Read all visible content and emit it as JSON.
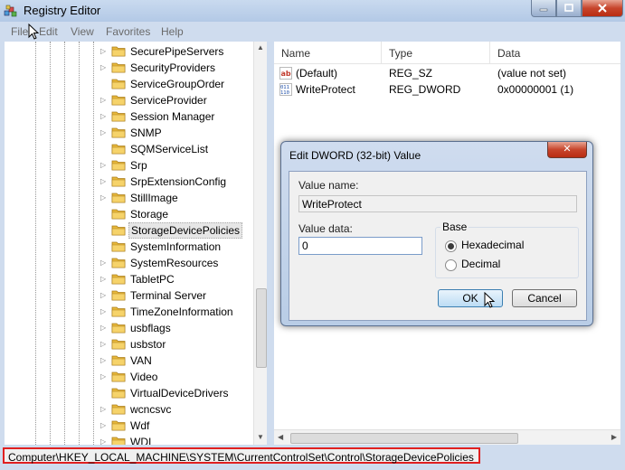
{
  "window": {
    "title": "Registry Editor"
  },
  "menu": [
    {
      "id": "file",
      "label": "File"
    },
    {
      "id": "edit",
      "label": "Edit"
    },
    {
      "id": "view",
      "label": "View"
    },
    {
      "id": "favorites",
      "label": "Favorites"
    },
    {
      "id": "help",
      "label": "Help"
    }
  ],
  "tree": {
    "items": [
      {
        "label": "SecurePipeServers",
        "expandable": true
      },
      {
        "label": "SecurityProviders",
        "expandable": true
      },
      {
        "label": "ServiceGroupOrder",
        "expandable": false
      },
      {
        "label": "ServiceProvider",
        "expandable": true
      },
      {
        "label": "Session Manager",
        "expandable": true
      },
      {
        "label": "SNMP",
        "expandable": true
      },
      {
        "label": "SQMServiceList",
        "expandable": false
      },
      {
        "label": "Srp",
        "expandable": true
      },
      {
        "label": "SrpExtensionConfig",
        "expandable": true
      },
      {
        "label": "StillImage",
        "expandable": true
      },
      {
        "label": "Storage",
        "expandable": false
      },
      {
        "label": "StorageDevicePolicies",
        "expandable": false,
        "selected": true
      },
      {
        "label": "SystemInformation",
        "expandable": false
      },
      {
        "label": "SystemResources",
        "expandable": true
      },
      {
        "label": "TabletPC",
        "expandable": true
      },
      {
        "label": "Terminal Server",
        "expandable": true
      },
      {
        "label": "TimeZoneInformation",
        "expandable": true
      },
      {
        "label": "usbflags",
        "expandable": true
      },
      {
        "label": "usbstor",
        "expandable": true
      },
      {
        "label": "VAN",
        "expandable": true
      },
      {
        "label": "Video",
        "expandable": true
      },
      {
        "label": "VirtualDeviceDrivers",
        "expandable": false
      },
      {
        "label": "wcncsvc",
        "expandable": true
      },
      {
        "label": "Wdf",
        "expandable": true
      },
      {
        "label": "WDI",
        "expandable": true
      }
    ]
  },
  "list": {
    "columns": [
      "Name",
      "Type",
      "Data"
    ],
    "rows": [
      {
        "icon": "string-value-icon",
        "name": "(Default)",
        "type": "REG_SZ",
        "data": "(value not set)"
      },
      {
        "icon": "binary-value-icon",
        "name": "WriteProtect",
        "type": "REG_DWORD",
        "data": "0x00000001 (1)"
      }
    ]
  },
  "dialog": {
    "title": "Edit DWORD (32-bit) Value",
    "close_glyph": "✕",
    "value_name_label": "Value name:",
    "value_name": "WriteProtect",
    "value_data_label": "Value data:",
    "value_data": "0",
    "base_label": "Base",
    "hex_label": "Hexadecimal",
    "dec_label": "Decimal",
    "hex_selected": true,
    "ok_label": "OK",
    "cancel_label": "Cancel"
  },
  "status": {
    "path": "Computer\\HKEY_LOCAL_MACHINE\\SYSTEM\\CurrentControlSet\\Control\\StorageDevicePolicies"
  },
  "colors": {
    "frame": "#cfdcee",
    "folder": "#e8b83a",
    "highlight_box": "#e02020"
  }
}
